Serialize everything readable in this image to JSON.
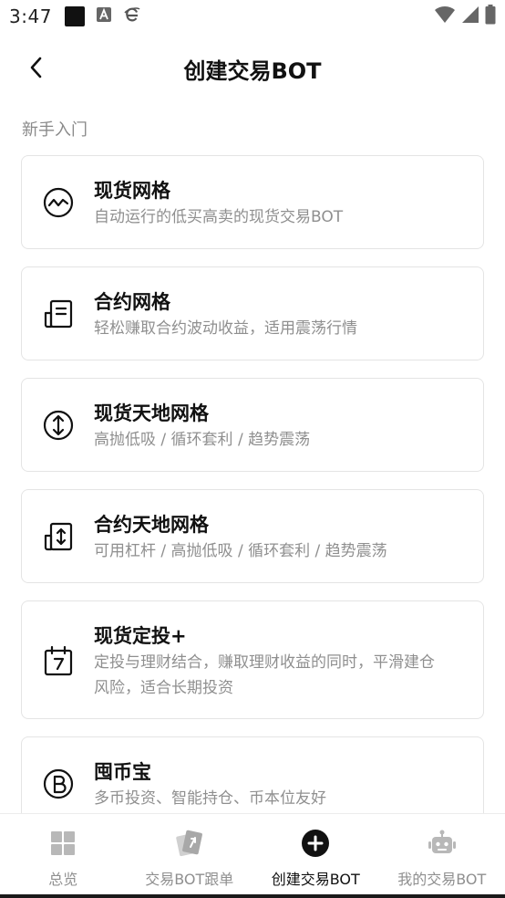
{
  "status_bar": {
    "time": "3:47",
    "icons": [
      "notification-square-icon",
      "a-box-icon",
      "browser-e-icon",
      "wifi-icon",
      "signal-icon",
      "battery-icon"
    ]
  },
  "header": {
    "back_icon": "chevron-left-icon",
    "title": "创建交易BOT"
  },
  "section": {
    "label": "新手入门"
  },
  "cards": [
    {
      "title": "现货网格",
      "desc": "自动运行的低买高卖的现货交易BOT",
      "icon": "wave-circle-icon"
    },
    {
      "title": "合约网格",
      "desc": "轻松赚取合约波动收益，适用震荡行情",
      "icon": "contract-document-icon"
    },
    {
      "title": "现货天地网格",
      "desc": "高抛低吸 / 循环套利 / 趋势震荡",
      "icon": "up-down-circle-icon"
    },
    {
      "title": "合约天地网格",
      "desc": "可用杠杆 / 高抛低吸 / 循环套利 / 趋势震荡",
      "icon": "up-down-box-icon"
    },
    {
      "title": "现货定投+",
      "desc_line1": "定投与理财结合，赚取理财收益的同时，平滑建仓",
      "desc_line2": "风险，适合长期投资",
      "icon": "calendar-icon"
    },
    {
      "title": "囤币宝",
      "desc": "多币投资、智能持仓、币本位友好",
      "icon": "bitcoin-circle-icon"
    }
  ],
  "bottom_nav": [
    {
      "label": "总览",
      "icon": "grid-icon",
      "active": false
    },
    {
      "label": "交易BOT跟单",
      "icon": "cards-icon",
      "active": false
    },
    {
      "label": "创建交易BOT",
      "icon": "plus-circle-icon",
      "active": true
    },
    {
      "label": "我的交易BOT",
      "icon": "robot-icon",
      "active": false
    }
  ],
  "colors": {
    "text_primary": "#111111",
    "text_secondary": "#8f8f8f",
    "card_border": "#e4e4e4",
    "nav_inactive_icon": "#b8b8b8"
  }
}
